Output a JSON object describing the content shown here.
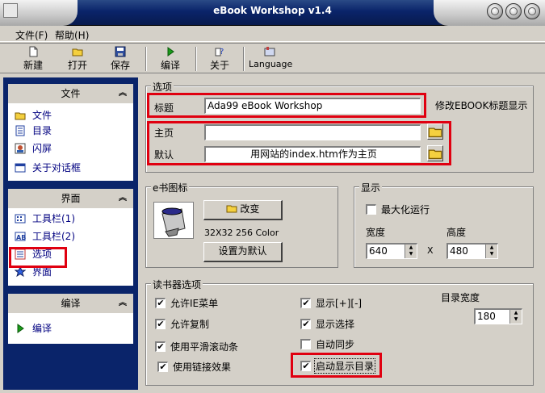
{
  "window": {
    "title": "eBook Workshop v1.4"
  },
  "menu": {
    "file": "文件(F)",
    "help": "帮助(H)"
  },
  "toolbar": {
    "new": "新建",
    "open": "打开",
    "save": "保存",
    "compile": "编译",
    "about": "关于",
    "language": "Language"
  },
  "sidebar": {
    "file_section": {
      "title": "文件",
      "items": [
        "文件",
        "目录",
        "闪屏",
        "关于对话框"
      ]
    },
    "interface_section": {
      "title": "界面",
      "items": [
        "工具栏(1)",
        "工具栏(2)",
        "选项",
        "界面"
      ]
    },
    "compile_section": {
      "title": "编译",
      "items": [
        "编译"
      ]
    }
  },
  "options": {
    "group_title": "选项",
    "title_label": "标题",
    "title_value": "Ada99 eBook Workshop",
    "title_hint": "修改EBOOK标题显示",
    "homepage_label": "主页",
    "homepage_value": "",
    "default_label": "默认",
    "default_value": "用网站的index.htm作为主页"
  },
  "icon": {
    "group_title": "e书图标",
    "change_button": "改变",
    "info": "32X32 256 Color",
    "default_button": "设置为默认"
  },
  "display": {
    "group_title": "显示",
    "maximize_label": "最大化运行",
    "width_label": "宽度",
    "height_label": "高度",
    "width_value": "640",
    "height_value": "480",
    "x_sep": "X"
  },
  "reader": {
    "group_title": "读书器选项",
    "allow_ie_menu": "允许IE菜单",
    "allow_copy": "允许复制",
    "smooth_scroll": "使用平滑滚动条",
    "link_effect": "使用链接效果",
    "show_plus_minus": "显示[+][-]",
    "show_selection": "显示选择",
    "auto_sync": "自动同步",
    "show_toc_on_start": "启动显示目录",
    "toc_width_label": "目录宽度",
    "toc_width_value": "180",
    "check_mark": "✔"
  },
  "colors": {
    "highlight": "#e00010",
    "sidebar_bg": "#0a246a",
    "link": "#000080"
  }
}
